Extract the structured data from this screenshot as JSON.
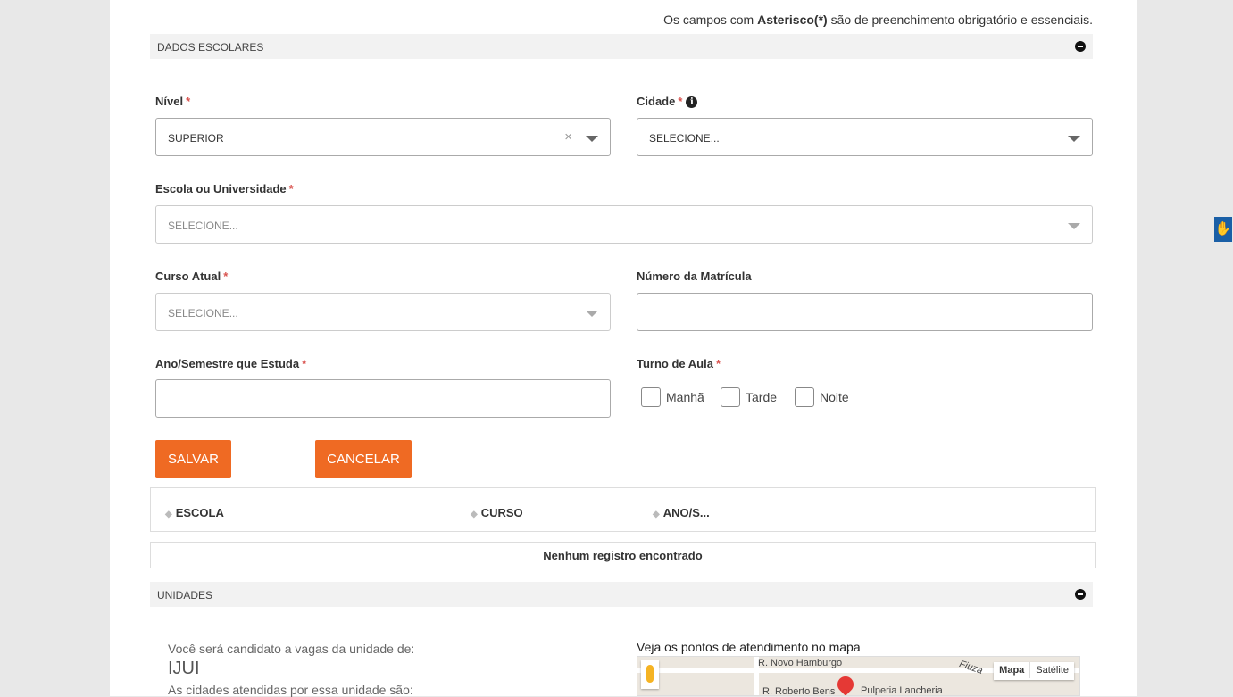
{
  "notice": {
    "prefix": "Os campos com ",
    "bold": "Asterisco(*)",
    "suffix": " são de preenchimento obrigatório e essenciais."
  },
  "dados_escolares": {
    "title": "DADOS ESCOLARES",
    "nivel": {
      "label": "Nível",
      "value": "SUPERIOR"
    },
    "cidade": {
      "label": "Cidade",
      "placeholder": "SELECIONE..."
    },
    "escola": {
      "label": "Escola ou Universidade",
      "placeholder": "SELECIONE..."
    },
    "curso": {
      "label": "Curso Atual",
      "placeholder": "SELECIONE..."
    },
    "matricula": {
      "label": "Número da Matrícula",
      "value": ""
    },
    "ano": {
      "label": "Ano/Semestre que Estuda",
      "value": ""
    },
    "turno": {
      "label": "Turno de Aula",
      "options": [
        "Manhã",
        "Tarde",
        "Noite"
      ]
    },
    "required_marker": "*",
    "buttons": {
      "save": "SALVAR",
      "cancel": "CANCELAR"
    },
    "table": {
      "columns": [
        "ESCOLA",
        "CURSO",
        "ANO/S..."
      ],
      "empty": "Nenhum registro encontrado"
    }
  },
  "unidades": {
    "title": "UNIDADES",
    "candidate_text": "Você será candidato a vagas da unidade de:",
    "unit_name": "IJUI",
    "cities_text": "As cidades atendidas por essa unidade são:",
    "map_title": "Veja os pontos de atendimento no mapa",
    "map": {
      "street_1": "R. Novo Hamburgo",
      "street_2": "R. Roberto Bens",
      "street_3": "Fiuza",
      "poi": "Pulperia Lancheria",
      "btn_map": "Mapa",
      "btn_satellite": "Satélite"
    }
  },
  "colors": {
    "accent": "#ef6a23",
    "required": "#d9534f"
  }
}
